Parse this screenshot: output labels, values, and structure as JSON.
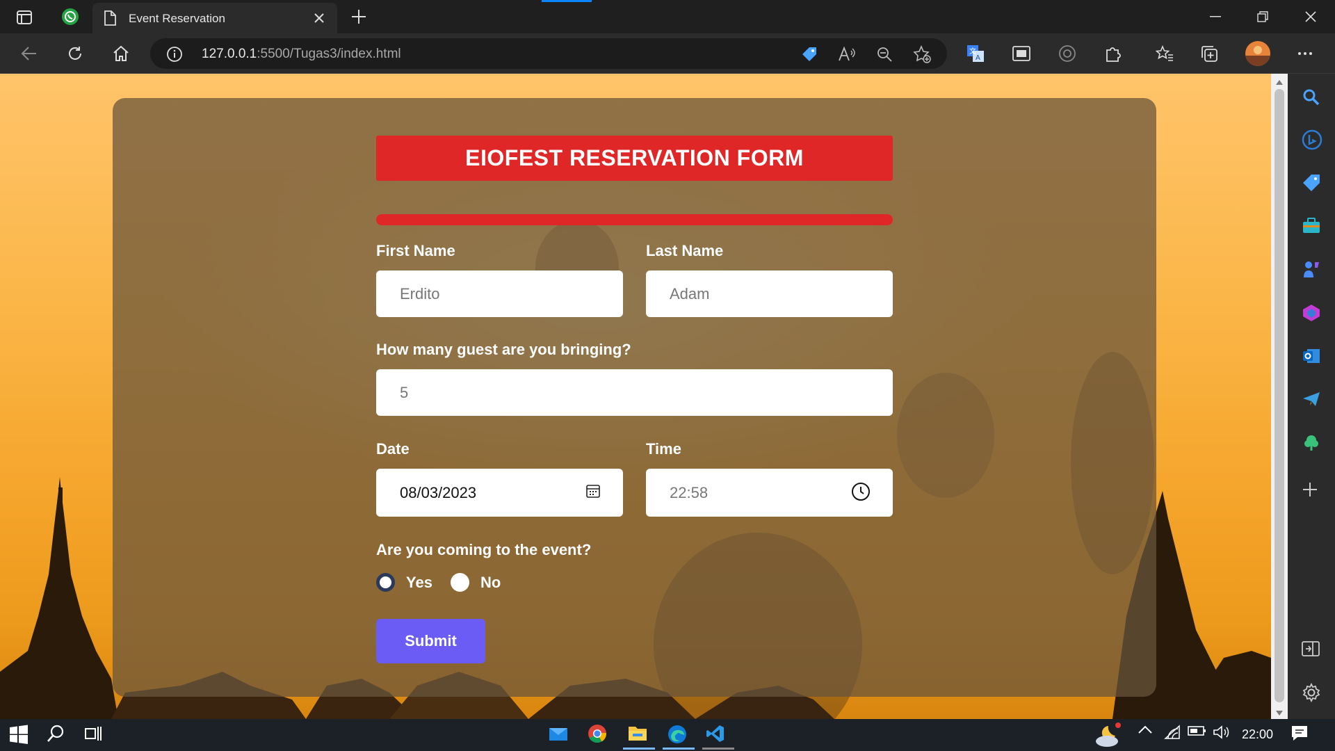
{
  "browser": {
    "tab_title": "Event Reservation",
    "url_host": "127.0.0.1",
    "url_rest": ":5500/Tugas3/index.html"
  },
  "form": {
    "title": "EIOFEST RESERVATION FORM",
    "first_name_label": "First Name",
    "first_name_value": "Erdito",
    "last_name_label": "Last Name",
    "last_name_value": "Adam",
    "guests_label": "How many guest are you bringing?",
    "guests_value": "5",
    "date_label": "Date",
    "date_value": "08/03/2023",
    "time_label": "Time",
    "time_value": "22:58",
    "attend_label": "Are you coming to the event?",
    "option_yes": "Yes",
    "option_no": "No",
    "selected_option": "Yes",
    "submit_label": "Submit",
    "colors": {
      "title_bg": "#e02727",
      "submit_bg": "#6a5cf5"
    }
  },
  "taskbar": {
    "time": "22:00"
  },
  "icons": {
    "titlebar": [
      "workspaces-icon",
      "whatsapp-icon",
      "page-icon",
      "close-icon",
      "plus-icon",
      "minimize-icon",
      "restore-icon",
      "close-window-icon"
    ],
    "toolbar": [
      "back-icon",
      "refresh-icon",
      "home-icon",
      "info-icon",
      "tag-icon",
      "read-aloud-icon",
      "zoom-out-icon",
      "add-favorite-icon",
      "translate-icon",
      "immersive-reader-icon",
      "copilot-icon",
      "extensions-icon",
      "favorites-icon",
      "collections-icon",
      "profile-avatar",
      "more-icon"
    ],
    "sidebar": [
      "search-icon",
      "bing-icon",
      "shopping-icon",
      "tools-icon",
      "games-icon",
      "office-icon",
      "outlook-icon",
      "telegram-icon",
      "tree-icon",
      "add-icon",
      "split-screen-icon",
      "settings-icon"
    ],
    "taskbar": [
      "windows-start-icon",
      "search-icon",
      "task-view-icon",
      "mail-icon",
      "chrome-icon",
      "file-explorer-icon",
      "edge-icon",
      "vscode-icon",
      "weather-icon",
      "chevron-up-icon",
      "wifi-icon",
      "battery-icon",
      "volume-icon",
      "notification-icon"
    ]
  }
}
